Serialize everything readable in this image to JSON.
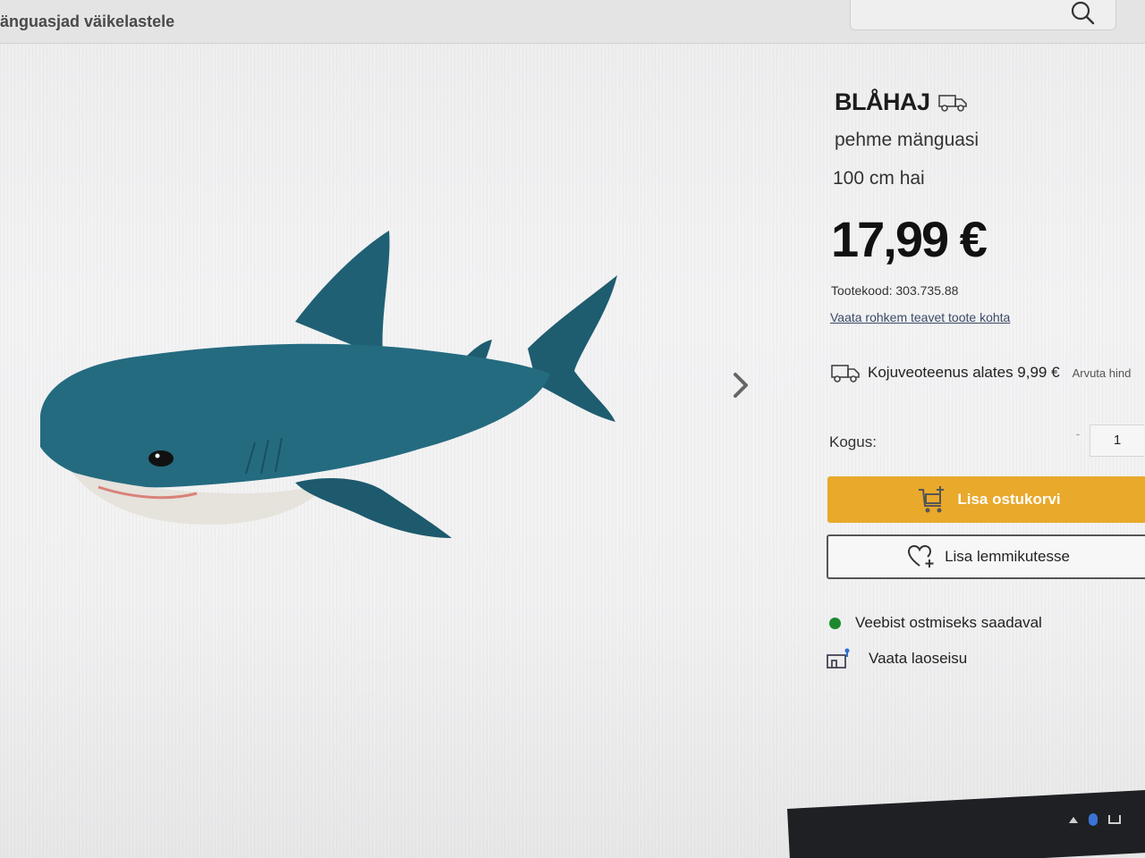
{
  "header": {
    "breadcrumb": "änguasjad väikelastele",
    "search_icon": "search-icon"
  },
  "product": {
    "name": "BLÅHAJ",
    "name_icon": "truck-icon",
    "type": "pehme mänguasi",
    "size": "100 cm hai",
    "price": "17,99 €",
    "code": "Tootekood: 303.735.88",
    "more_info_link": "Vaata rohkem teavet toote kohta",
    "image_icon": "shark-plush-image"
  },
  "gallery": {
    "next_icon": "chevron-right-icon"
  },
  "delivery": {
    "text": "Kojuveoteenus alates 9,99 €",
    "calc_link": "Arvuta hind",
    "icon": "truck-icon"
  },
  "quantity": {
    "label": "Kogus:",
    "minus": "-",
    "value": "1"
  },
  "actions": {
    "add_to_cart": "Lisa ostukorvi",
    "add_to_favorites": "Lisa lemmikutesse",
    "cart_color": "#e9a92b"
  },
  "availability": {
    "online": "Veebist ostmiseks saadaval",
    "online_color": "#1c8a2c",
    "stock_link": "Vaata laoseisu"
  }
}
